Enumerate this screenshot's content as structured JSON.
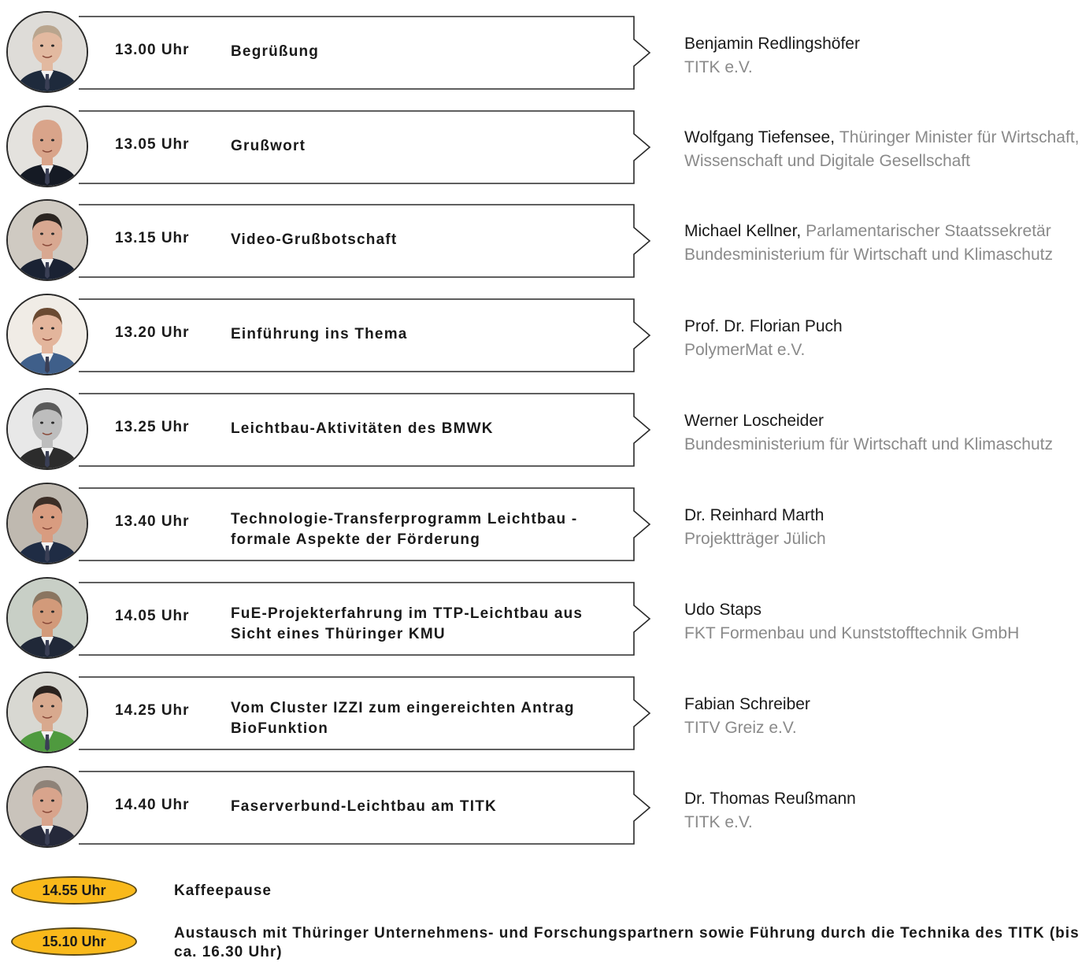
{
  "agenda": [
    {
      "time": "13.00 Uhr",
      "title": "Begrüßung",
      "name": "Benjamin Redlingshöfer",
      "name_sep": "",
      "affiliation": "TITK e.V.",
      "inline": false,
      "avatar": {
        "skin": "#e2b9a0",
        "hair": "#b9a58e",
        "suit": "#1e2a3c",
        "bg": "#dedcd8"
      }
    },
    {
      "time": "13.05 Uhr",
      "title": "Grußwort",
      "name": "Wolfgang Tiefensee,",
      "name_sep": " ",
      "affiliation": "Thüringer Minister für Wirtschaft, Wissenschaft und Digitale Gesellschaft",
      "inline": true,
      "avatar": {
        "skin": "#d9a48a",
        "hair": "#d9a48a",
        "suit": "#151a24",
        "bg": "#e4e2de"
      }
    },
    {
      "time": "13.15 Uhr",
      "title": "Video-Grußbotschaft",
      "name": "Michael Kellner,",
      "name_sep": " ",
      "affiliation": "Parlamentarischer Staatssekretär Bundesministerium für Wirtschaft und Klimaschutz",
      "inline": true,
      "avatar": {
        "skin": "#d8a891",
        "hair": "#2a2420",
        "suit": "#1a2233",
        "bg": "#cfcac2"
      }
    },
    {
      "time": "13.20 Uhr",
      "title": "Einführung ins Thema",
      "name": "Prof. Dr. Florian Puch",
      "name_sep": "",
      "affiliation": "PolymerMat e.V.",
      "inline": false,
      "avatar": {
        "skin": "#e3b59c",
        "hair": "#6a4a32",
        "suit": "#3f5f8a",
        "bg": "#f0ece6"
      }
    },
    {
      "time": "13.25 Uhr",
      "title": "Leichtbau-Aktivitäten des BMWK",
      "name": "Werner Loscheider",
      "name_sep": "",
      "affiliation": "Bundesministerium für Wirtschaft und Klimaschutz",
      "inline": false,
      "avatar": {
        "skin": "#bdbdbd",
        "hair": "#5a5a5a",
        "suit": "#2c2c2c",
        "bg": "#e8e8e8"
      }
    },
    {
      "time": "13.40 Uhr",
      "title": "Technologie-Transferprogramm Leichtbau - formale Aspekte der Förderung",
      "name": "Dr. Reinhard Marth",
      "name_sep": "",
      "affiliation": "Projektträger Jülich",
      "inline": false,
      "avatar": {
        "skin": "#d89c80",
        "hair": "#3c2e26",
        "suit": "#1f2c44",
        "bg": "#bfb9b0"
      }
    },
    {
      "time": "14.05 Uhr",
      "title": "FuE-Projekterfahrung im TTP-Leichtbau aus Sicht eines Thüringer KMU",
      "name": "Udo Staps",
      "name_sep": "",
      "affiliation": "FKT Formenbau und Kunststofftechnik GmbH",
      "inline": false,
      "avatar": {
        "skin": "#d29a7a",
        "hair": "#8a7560",
        "suit": "#202838",
        "bg": "#c8cfc6"
      }
    },
    {
      "time": "14.25 Uhr",
      "title": "Vom Cluster IZZI zum eingereichten Antrag BioFunktion",
      "name": "Fabian Schreiber",
      "name_sep": "",
      "affiliation": "TITV Greiz e.V.",
      "inline": false,
      "avatar": {
        "skin": "#d8a98e",
        "hair": "#2a221e",
        "suit": "#4f9a3f",
        "bg": "#d8d8d2"
      }
    },
    {
      "time": "14.40 Uhr",
      "title": "Faserverbund-Leichtbau am TITK",
      "name": "Dr. Thomas Reußmann",
      "name_sep": "",
      "affiliation": "TITK e.V.",
      "inline": false,
      "avatar": {
        "skin": "#d8a48c",
        "hair": "#8e8278",
        "suit": "#25293a",
        "bg": "#c9c3bb"
      }
    }
  ],
  "breaks": [
    {
      "time": "14.55 Uhr",
      "text": "Kaffeepause"
    },
    {
      "time": "15.10 Uhr",
      "text": "Austausch mit Thüringer Unternehmens- und Forschungspartnern sowie Führung durch die Technika des TITK (bis ca. 16.30 Uhr)"
    }
  ],
  "colors": {
    "accent": "#f9b91b",
    "frame": "#2a2a2a",
    "muted": "#8a8a8a"
  }
}
